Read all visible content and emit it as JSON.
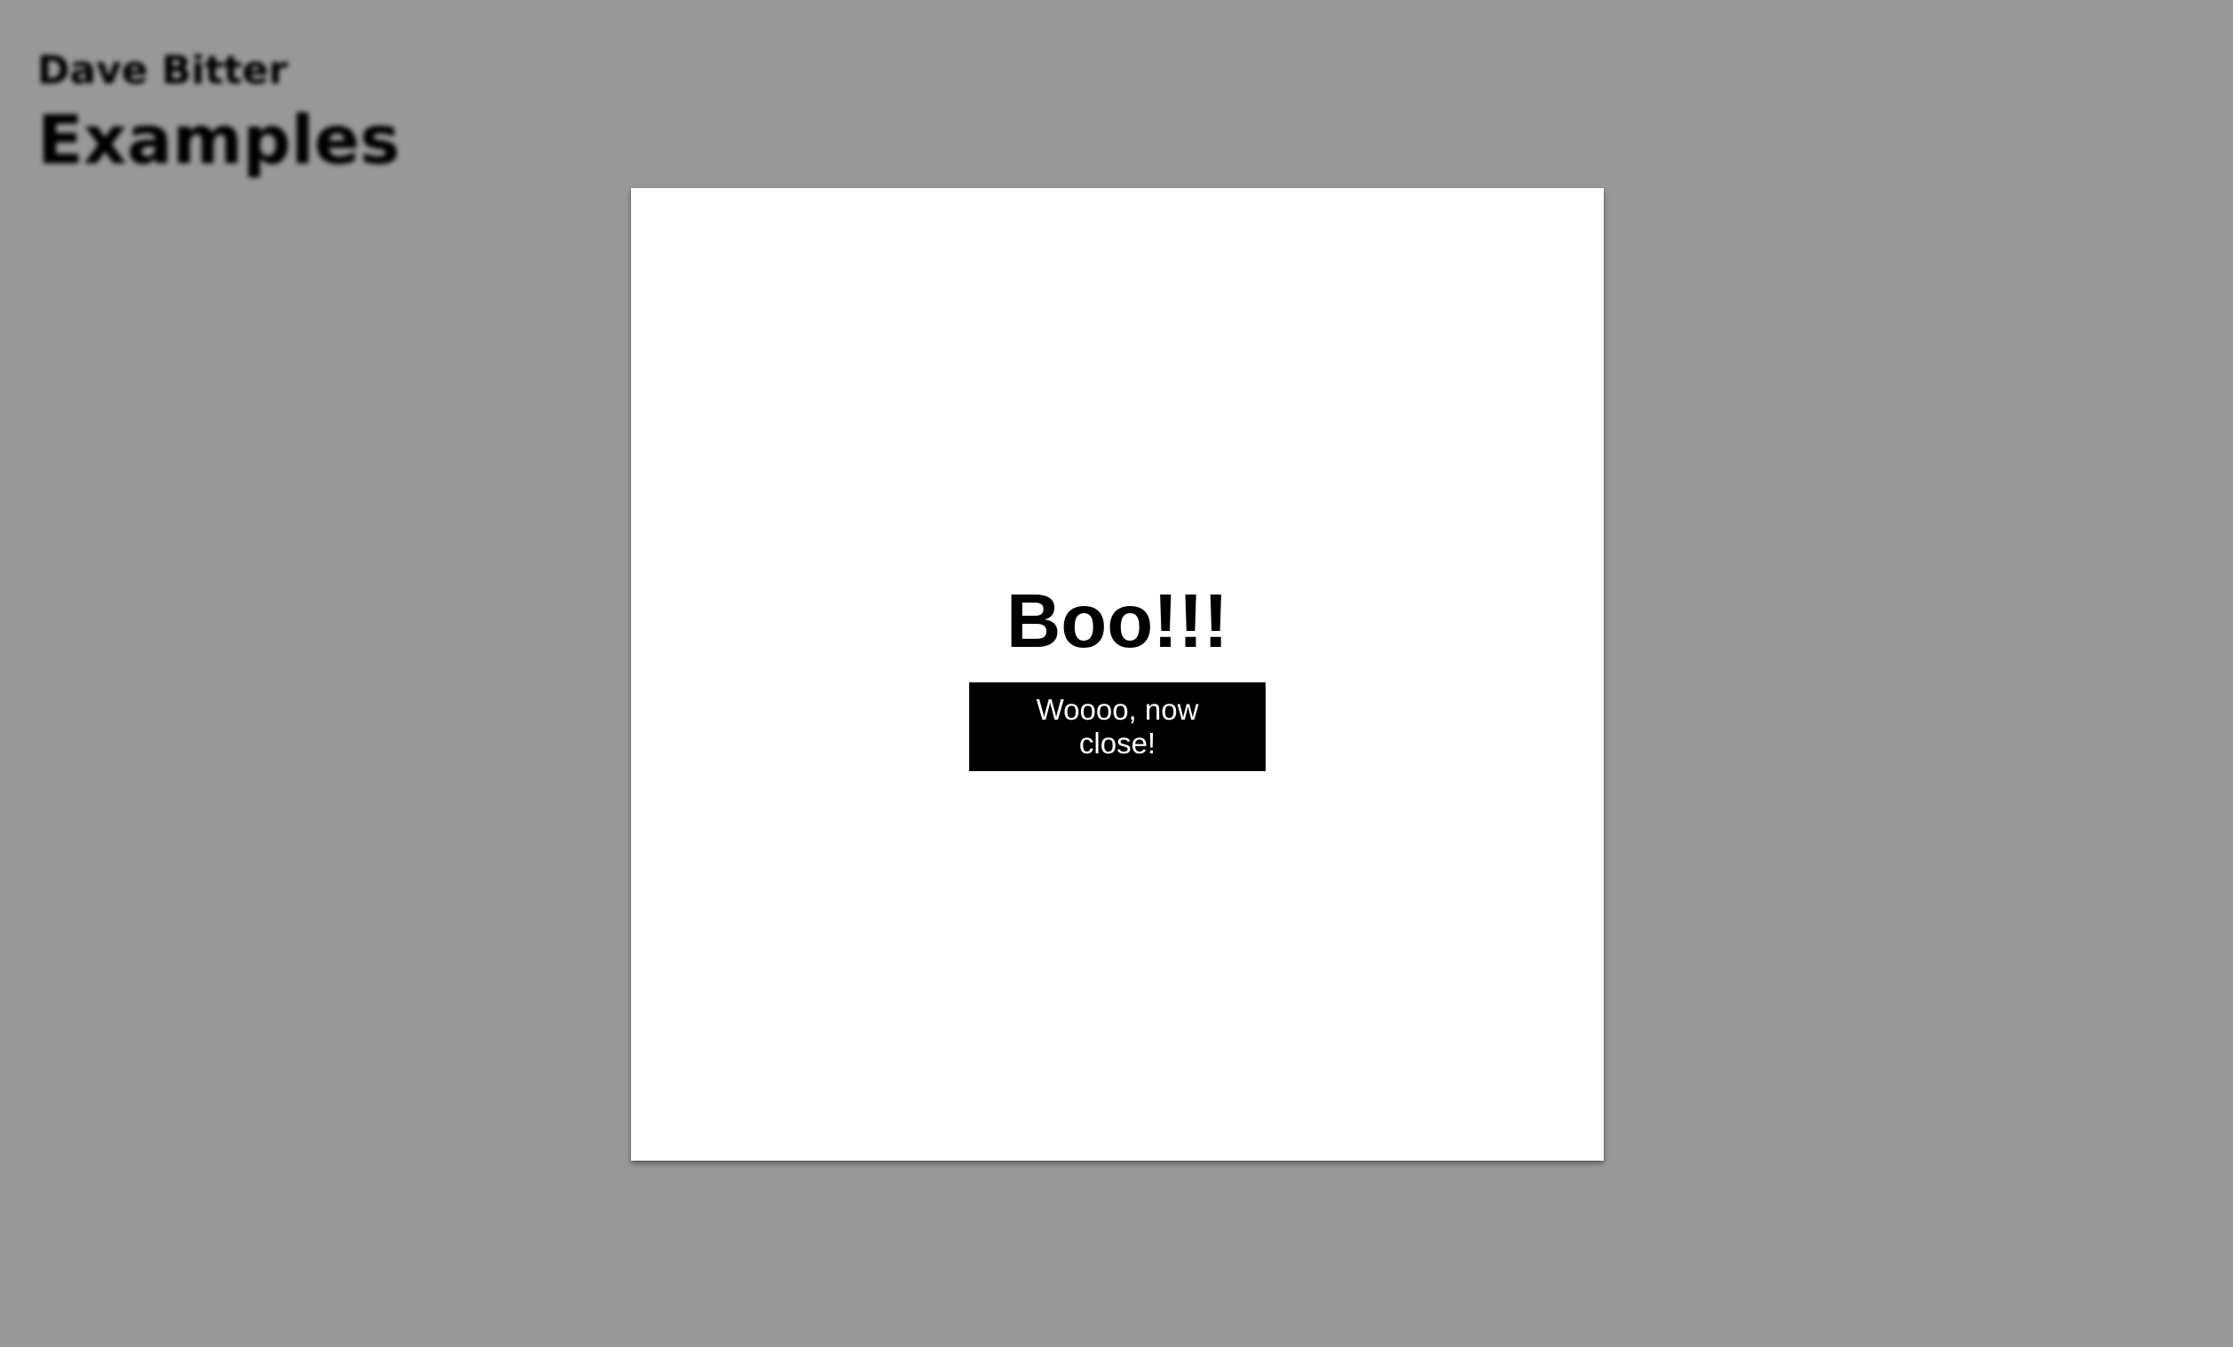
{
  "page": {
    "site_name": "Dave Bitter",
    "title": "Examples"
  },
  "dialog": {
    "title": "Boo!!!",
    "close_label": "Woooo, now close!"
  }
}
